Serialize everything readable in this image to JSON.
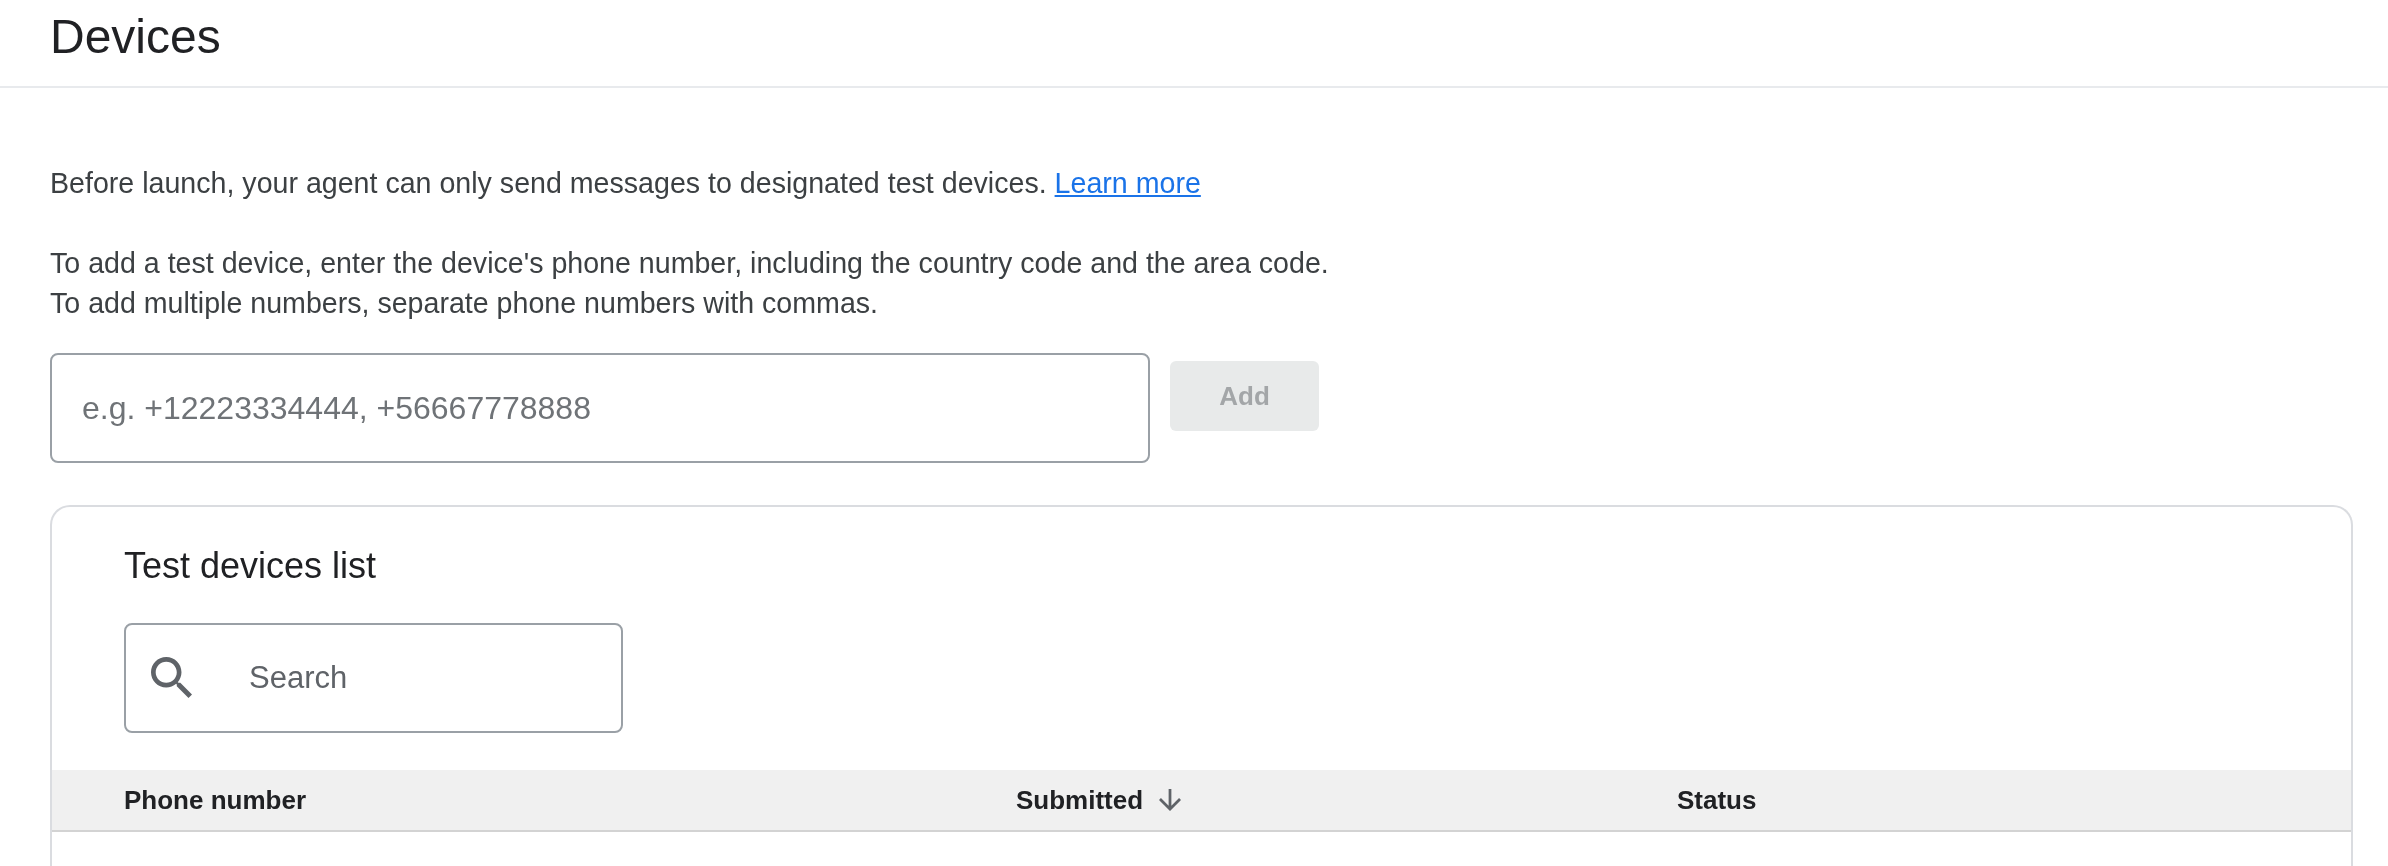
{
  "page": {
    "title": "Devices"
  },
  "intro": {
    "text": "Before launch, your agent can only send messages to designated test devices.",
    "link": "Learn more"
  },
  "instructions": [
    "To add a test device, enter the device's phone number, including the country code and the area code.",
    "To add multiple numbers, separate phone numbers with commas."
  ],
  "phone_input": {
    "placeholder": "e.g. +12223334444, +56667778888"
  },
  "add_button": {
    "label": "Add",
    "disabled": true
  },
  "test_devices": {
    "title": "Test devices list",
    "search": {
      "placeholder": "Search"
    },
    "columns": [
      {
        "label": "Phone number",
        "sorted": false
      },
      {
        "label": "Submitted",
        "sorted": true
      },
      {
        "label": "Status",
        "sorted": false
      }
    ]
  }
}
